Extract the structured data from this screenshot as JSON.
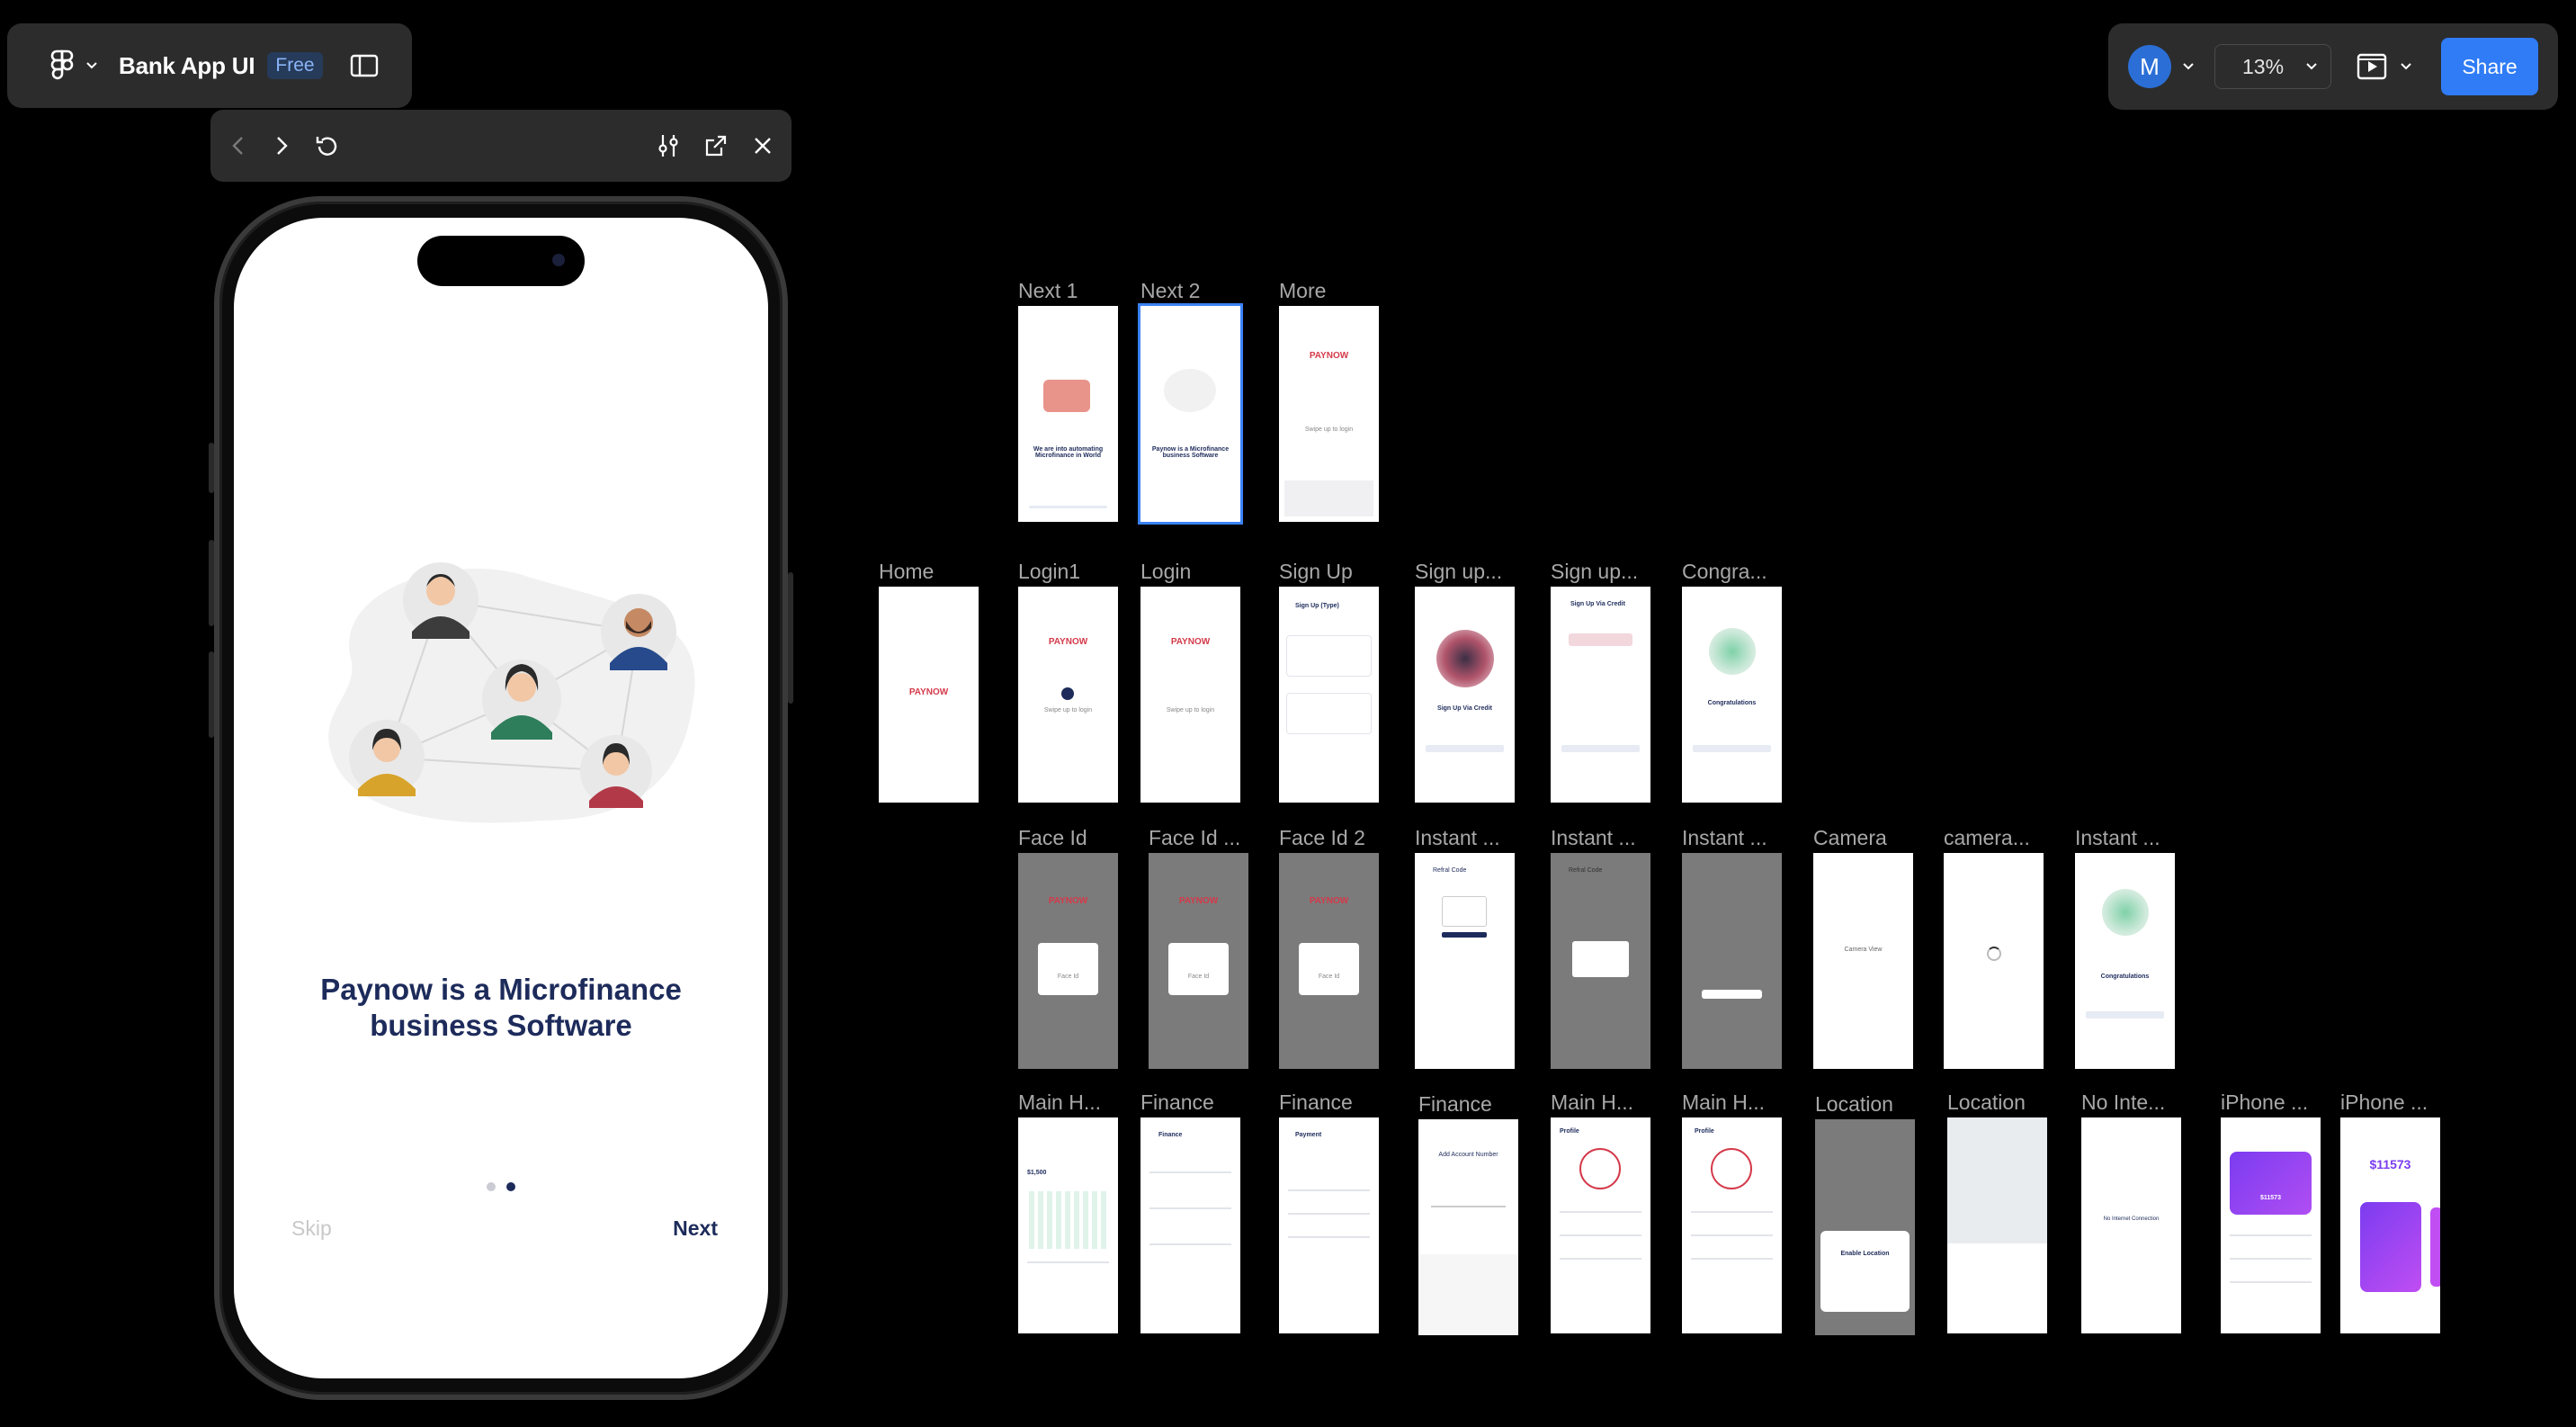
{
  "app": {
    "file_name": "Bank App UI",
    "plan_badge": "Free",
    "avatar_initial": "M",
    "zoom": "13%",
    "share_label": "Share"
  },
  "preview": {
    "headline": "Paynow is a Microfinance business  Software",
    "skip_label": "Skip",
    "next_label": "Next",
    "pagination": {
      "count": 2,
      "active": 2
    }
  },
  "brand": {
    "pay": "PAY",
    "now": "NOW"
  },
  "frames": [
    {
      "id": "next1",
      "label": "Next 1",
      "caption": "We are into automating Microfinance in World"
    },
    {
      "id": "next2",
      "label": "Next 2",
      "caption": "Paynow is a Microfinance business Software"
    },
    {
      "id": "more",
      "label": "More",
      "caption": "Swipe up to login"
    },
    {
      "id": "home",
      "label": "Home"
    },
    {
      "id": "login1",
      "label": "Login1",
      "caption": "Swipe up to login"
    },
    {
      "id": "login",
      "label": "Login",
      "caption": "Swipe up to login"
    },
    {
      "id": "signup",
      "label": "Sign Up",
      "caption": "Sign Up (Type)"
    },
    {
      "id": "signup2",
      "label": "Sign up...",
      "caption": "Sign Up Via Credit"
    },
    {
      "id": "signup3",
      "label": "Sign up...",
      "caption": "Sign Up Via Credit"
    },
    {
      "id": "congra",
      "label": "Congra...",
      "caption": "Congratulations"
    },
    {
      "id": "faceid",
      "label": "Face Id",
      "caption": "Face Id"
    },
    {
      "id": "faceid1",
      "label": "Face Id ...",
      "caption": "Face Id"
    },
    {
      "id": "faceid2",
      "label": "Face Id 2",
      "caption": "Face Id"
    },
    {
      "id": "instant1",
      "label": "Instant ...",
      "caption": "Refral Code"
    },
    {
      "id": "instant2",
      "label": "Instant ...",
      "caption": "Refral Code"
    },
    {
      "id": "instant3",
      "label": "Instant ...",
      "caption": ""
    },
    {
      "id": "camera",
      "label": "Camera",
      "caption": "Camera View"
    },
    {
      "id": "camera2",
      "label": "camera...",
      "caption": ""
    },
    {
      "id": "instant4",
      "label": "Instant ...",
      "caption": "Congratulations"
    },
    {
      "id": "mainh1",
      "label": "Main H...",
      "caption": "$1,500"
    },
    {
      "id": "finance1",
      "label": "Finance",
      "caption": "Finance"
    },
    {
      "id": "finance2",
      "label": "Finance",
      "caption": "Payment"
    },
    {
      "id": "finance3",
      "label": "Finance",
      "caption": "Add Account Number"
    },
    {
      "id": "mainh2",
      "label": "Main H...",
      "caption": "Profile"
    },
    {
      "id": "mainh3",
      "label": "Main H...",
      "caption": "Profile"
    },
    {
      "id": "location1",
      "label": "Location",
      "caption": "Enable Location"
    },
    {
      "id": "location2",
      "label": "Location",
      "caption": ""
    },
    {
      "id": "nointe",
      "label": "No Inte...",
      "caption": "No Internet Connection"
    },
    {
      "id": "iphone1",
      "label": "iPhone ...",
      "caption": "$11573"
    },
    {
      "id": "iphone2",
      "label": "iPhone ...",
      "caption": "$11573"
    }
  ],
  "colors": {
    "accent": "#2f7cf6",
    "brand_navy": "#1d2b5b",
    "brand_red": "#d43a4a",
    "panel": "#2c2c2c"
  },
  "icons": [
    "figma-logo-icon",
    "chevron-down-icon",
    "sidebar-toggle-icon",
    "back-arrow-icon",
    "forward-arrow-icon",
    "restart-icon",
    "settings-sliders-icon",
    "open-external-icon",
    "close-icon",
    "present-icon"
  ]
}
